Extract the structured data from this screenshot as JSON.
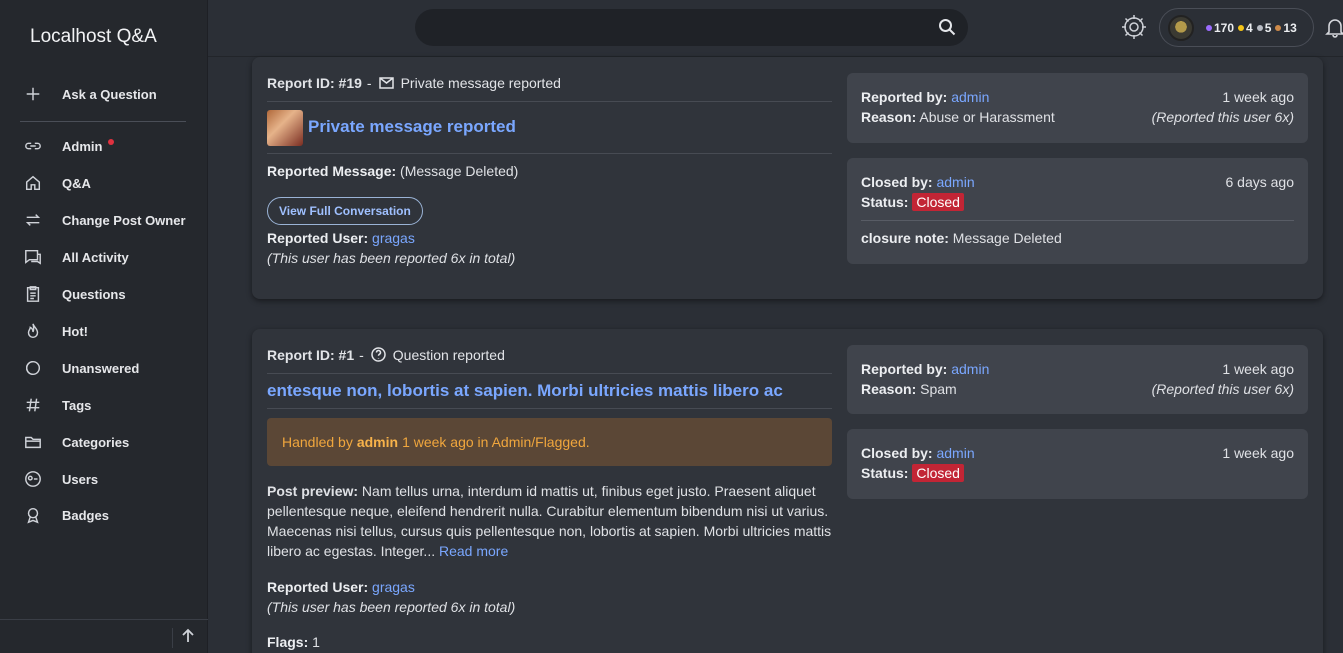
{
  "sidebar": {
    "brand": "Localhost Q&A",
    "ask": "Ask a Question",
    "items": [
      {
        "label": "Admin",
        "icon": "link-icon"
      },
      {
        "label": "Q&A",
        "icon": "home-icon"
      },
      {
        "label": "Change Post Owner",
        "icon": "swap-icon"
      },
      {
        "label": "All Activity",
        "icon": "chat-icon"
      },
      {
        "label": "Questions",
        "icon": "list-icon"
      },
      {
        "label": "Hot!",
        "icon": "fire-icon"
      },
      {
        "label": "Unanswered",
        "icon": "half-moon-icon"
      },
      {
        "label": "Tags",
        "icon": "hash-icon"
      },
      {
        "label": "Categories",
        "icon": "folder-icon"
      },
      {
        "label": "Users",
        "icon": "users-icon"
      },
      {
        "label": "Badges",
        "icon": "badge-icon"
      }
    ]
  },
  "topbar": {
    "search_placeholder": "",
    "points": "170",
    "gold": "4",
    "silver": "5",
    "bronze": "13",
    "colors": {
      "points": "#9b6cff",
      "gold": "#f5c518",
      "silver": "#b8bcc4",
      "bronze": "#cd8a4a"
    }
  },
  "report1": {
    "id_label": "Report ID: #19",
    "sep": "-",
    "type": "Private message reported",
    "title": "Private message reported",
    "msg_label": "Reported Message:",
    "msg_value": "(Message Deleted)",
    "button": "View Full Conversation",
    "user_label": "Reported User:",
    "user": "gragas",
    "user_note": "(This user has been reported 6x in total)",
    "reported_by_label": "Reported by:",
    "reported_by": "admin",
    "reported_time": "1 week ago",
    "reason_label": "Reason:",
    "reason": "Abuse or Harassment",
    "reported_count": "(Reported this user 6x)",
    "closed_by_label": "Closed by:",
    "closed_by": "admin",
    "closed_time": "6 days ago",
    "status_label": "Status:",
    "status": "Closed",
    "note_label": "closure note:",
    "note": "Message Deleted"
  },
  "report2": {
    "id_label": "Report ID: #1",
    "sep": "-",
    "type": "Question reported",
    "title": "entesque non, lobortis at sapien. Morbi ultricies mattis libero ac",
    "handled_pre": "Handled by",
    "handled_user": "admin",
    "handled_post": "1 week ago in Admin/Flagged.",
    "preview_label": "Post preview:",
    "preview_text": "Nam tellus urna, interdum id mattis ut, finibus eget justo. Praesent aliquet pellentesque neque, eleifend hendrerit nulla. Curabitur elementum bibendum nisi ut varius. Maecenas nisi tellus, cursus quis pellentesque non, lobortis at sapien. Morbi ultricies mattis libero ac egestas. Integer...",
    "read_more": "Read more",
    "user_label": "Reported User:",
    "user": "gragas",
    "user_note": "(This user has been reported 6x in total)",
    "flags_label": "Flags:",
    "flags": "1",
    "reported_by_label": "Reported by:",
    "reported_by": "admin",
    "reported_time": "1 week ago",
    "reason_label": "Reason:",
    "reason": "Spam",
    "reported_count": "(Reported this user 6x)",
    "closed_by_label": "Closed by:",
    "closed_by": "admin",
    "closed_time": "1 week ago",
    "status_label": "Status:",
    "status": "Closed"
  }
}
